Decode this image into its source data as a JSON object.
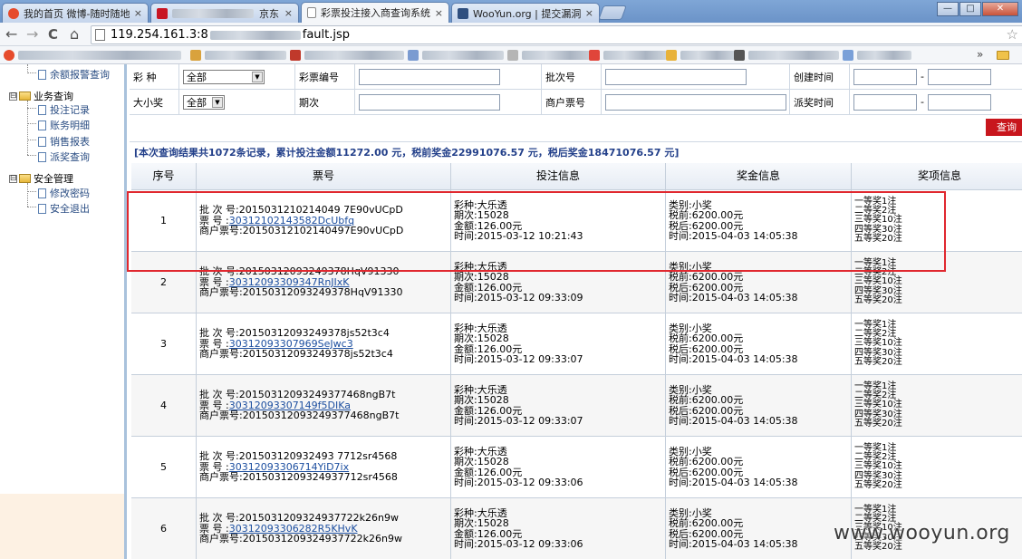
{
  "browser": {
    "tabs": [
      {
        "label": "我的首页 微博-随时随地",
        "favicon_color": "#e64b2c",
        "active": false
      },
      {
        "label": "京东",
        "favicon_color": "#c81623",
        "active": false
      },
      {
        "label": "彩票投注接入商查询系统",
        "favicon_color": "#ffffff",
        "active": true
      },
      {
        "label": "WooYun.org | 提交漏洞",
        "favicon_color": "#2f4f7f",
        "active": false
      }
    ],
    "tab_close_glyph": "×",
    "window_buttons": [
      "—",
      "□",
      "✕"
    ],
    "nav": {
      "back": "←",
      "forward": "→",
      "reload": "C",
      "home": "⌂"
    },
    "url_prefix": "119.254.161.3:8",
    "url_suffix": "fault.jsp",
    "star_glyph": "☆",
    "bookmarks_more": "»"
  },
  "sidebar": {
    "items": [
      {
        "label": "余额报警查询",
        "kind": "link"
      },
      {
        "label": "业务查询",
        "kind": "group",
        "expander": "⊟"
      },
      {
        "label": "投注记录",
        "kind": "link"
      },
      {
        "label": "账务明细",
        "kind": "link"
      },
      {
        "label": "销售报表",
        "kind": "link"
      },
      {
        "label": "派奖查询",
        "kind": "link"
      },
      {
        "label": "安全管理",
        "kind": "group",
        "expander": "⊟"
      },
      {
        "label": "修改密码",
        "kind": "link"
      },
      {
        "label": "安全退出",
        "kind": "link"
      }
    ]
  },
  "filters": {
    "row1": {
      "lottery_type_label": "彩 种",
      "lottery_type_value": "全部",
      "lottery_no_label": "彩票编号",
      "batch_no_label": "批次号",
      "create_time_label": "创建时间",
      "range_sep": "-"
    },
    "row2": {
      "size_prize_label": "大小奖",
      "size_prize_value": "全部",
      "period_label": "期次",
      "merchant_ticket_label": "商户票号",
      "award_time_label": "派奖时间",
      "range_sep": "-"
    },
    "query_button": "查询"
  },
  "summary": "[本次查询结果共1072条记录，累计投注金额11272.00 元，税前奖金22991076.57 元，税后奖金18471076.57 元]",
  "table": {
    "headers": [
      "序号",
      "票号",
      "投注信息",
      "奖金信息",
      "奖项信息"
    ],
    "rows": [
      {
        "seq": "1",
        "batch": "批 次 号:2015031210214049 7E90vUCpD",
        "ticket": "30312102143582DcUbfq",
        "merchant": "商户票号:20150312102140497E90vUCpD",
        "bet": [
          "彩种:大乐透",
          "期次:15028",
          "金额:126.00元",
          "时间:2015-03-12 10:21:43"
        ],
        "prize": [
          "类别:小奖",
          "税前:6200.00元",
          "税后:6200.00元",
          "时间:2015-04-03 14:05:38"
        ],
        "awards": [
          "一等奖1注",
          "二等奖2注",
          "三等奖10注",
          "四等奖30注",
          "五等奖20注"
        ]
      },
      {
        "seq": "2",
        "batch": "批 次 号:20150312093249378HqV91330",
        "ticket": "30312093309347RnJIxK",
        "merchant": "商户票号:20150312093249378HqV91330",
        "bet": [
          "彩种:大乐透",
          "期次:15028",
          "金额:126.00元",
          "时间:2015-03-12 09:33:09"
        ],
        "prize": [
          "类别:小奖",
          "税前:6200.00元",
          "税后:6200.00元",
          "时间:2015-04-03 14:05:38"
        ],
        "awards": [
          "一等奖1注",
          "二等奖2注",
          "三等奖10注",
          "四等奖30注",
          "五等奖20注"
        ]
      },
      {
        "seq": "3",
        "batch": "批 次 号:20150312093249378js52t3c4",
        "ticket": "30312093307969SeJwc3",
        "merchant": "商户票号:20150312093249378js52t3c4",
        "bet": [
          "彩种:大乐透",
          "期次:15028",
          "金额:126.00元",
          "时间:2015-03-12 09:33:07"
        ],
        "prize": [
          "类别:小奖",
          "税前:6200.00元",
          "税后:6200.00元",
          "时间:2015-04-03 14:05:38"
        ],
        "awards": [
          "一等奖1注",
          "二等奖2注",
          "三等奖10注",
          "四等奖30注",
          "五等奖20注"
        ]
      },
      {
        "seq": "4",
        "batch": "批 次 号:20150312093249377468ngB7t",
        "ticket": "30312093307149f5DIKa",
        "merchant": "商户票号:20150312093249377468ngB7t",
        "bet": [
          "彩种:大乐透",
          "期次:15028",
          "金额:126.00元",
          "时间:2015-03-12 09:33:07"
        ],
        "prize": [
          "类别:小奖",
          "税前:6200.00元",
          "税后:6200.00元",
          "时间:2015-04-03 14:05:38"
        ],
        "awards": [
          "一等奖1注",
          "二等奖2注",
          "三等奖10注",
          "四等奖30注",
          "五等奖20注"
        ]
      },
      {
        "seq": "5",
        "batch": "批 次 号:201503120932493 7712sr4568",
        "ticket": "30312093306714YiD7ix",
        "merchant": "商户票号:2015031209324937712sr4568",
        "bet": [
          "彩种:大乐透",
          "期次:15028",
          "金额:126.00元",
          "时间:2015-03-12 09:33:06"
        ],
        "prize": [
          "类别:小奖",
          "税前:6200.00元",
          "税后:6200.00元",
          "时间:2015-04-03 14:05:38"
        ],
        "awards": [
          "一等奖1注",
          "二等奖2注",
          "三等奖10注",
          "四等奖30注",
          "五等奖20注"
        ]
      },
      {
        "seq": "6",
        "batch": "批 次 号:2015031209324937722k26n9w",
        "ticket": "30312093306282R5KHvK",
        "merchant": "商户票号:2015031209324937722k26n9w",
        "bet": [
          "彩种:大乐透",
          "期次:15028",
          "金额:126.00元",
          "时间:2015-03-12 09:33:06"
        ],
        "prize": [
          "类别:小奖",
          "税前:6200.00元",
          "税后:6200.00元",
          "时间:2015-04-03 14:05:38"
        ],
        "awards": [
          "一等奖1注",
          "二等奖2注",
          "三等奖10注",
          "四等奖30注",
          "五等奖20注"
        ]
      }
    ]
  },
  "ticket_prefix": "票 号 :",
  "watermark": "www.wooyun.org",
  "colors": {
    "highlight": "#e0282f",
    "query_button": "#c8161d",
    "summary_text": "#23408a",
    "link": "#1d4fa0"
  }
}
